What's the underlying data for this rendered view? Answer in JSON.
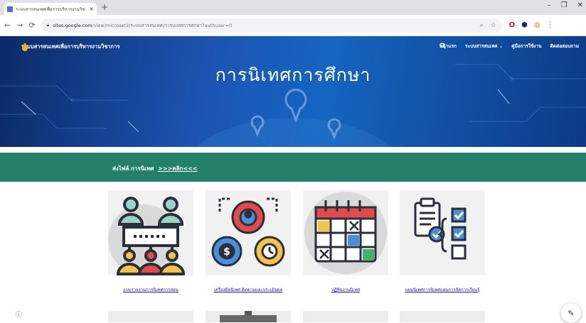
{
  "browser": {
    "tab_title": "ระบบสารสนเทศเพื่อการบริหารงานวิชาการ",
    "tab_close": "×",
    "new_tab": "+",
    "url_host": "sites.google.com",
    "url_path": "/view/microset2/ระบบสารสนเทศ/การนเทศการศกษา?authuser=0",
    "window_controls": [
      "–",
      "❐",
      "✕"
    ]
  },
  "site": {
    "title": "ระบบสารสนเทศเพื่อการบริหารงานวิชาการ",
    "menu": [
      {
        "label": "หน้าแรก"
      },
      {
        "label": "ระบบสารสนเทศ ⌄"
      },
      {
        "label": "คู่มือการใช้งาน"
      },
      {
        "label": "ติดต่อสอบถาม"
      }
    ],
    "search_icon": "search-icon"
  },
  "hero": {
    "heading": "การนิเทศการศึกษา"
  },
  "banner": {
    "text": "ส่งไฟล์ การนิเทศ",
    "link": ">>>คลิก<<<",
    "color": "#25806a"
  },
  "cards": [
    {
      "caption": "แบบรายงานการนิเทศการสอน",
      "icon": "team-hierarchy-icon"
    },
    {
      "caption": "เครื่องมือนิเทศ ติดตามและประเมินผล",
      "icon": "gears-people-money-time-icon"
    },
    {
      "caption": "ปฏิทินงานนิเทศ",
      "icon": "calendar-icon"
    },
    {
      "caption": "แผนนิเทศการนิเทศแผนการจัดการเรียนรู้",
      "icon": "checklist-icon"
    }
  ],
  "colors": {
    "hero_dark": "#0a2a66",
    "hero_light": "#1565c0",
    "accent_green": "#25806a"
  }
}
